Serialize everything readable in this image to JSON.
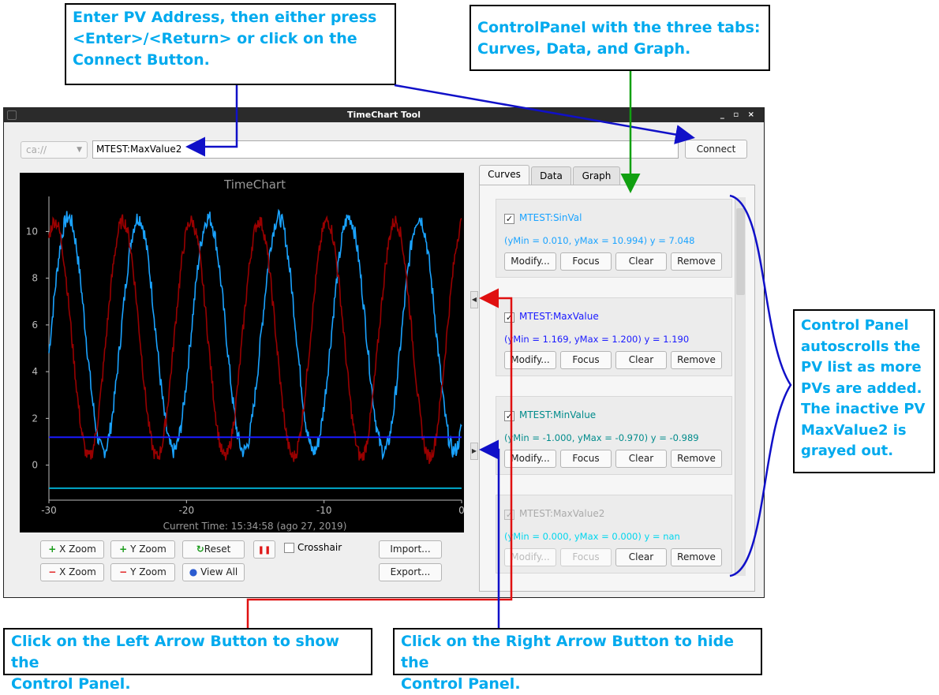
{
  "annotations": {
    "pv_address": [
      "Enter PV Address, then either press",
      "<Enter>/<Return> or click on the",
      "Connect Button."
    ],
    "control_panel_tabs": [
      "ControlPanel with the three tabs:",
      "Curves, Data, and Graph."
    ],
    "autoscroll": [
      "Control Panel",
      "autoscrolls the",
      "PV list as more",
      "PVs are added.",
      "The inactive PV",
      "MaxValue2 is",
      "grayed out."
    ],
    "left_arrow": [
      "Click on the Left Arrow Button to show the",
      "Control Panel."
    ],
    "right_arrow": [
      "Click on the Right Arrow Button to hide the",
      "Control Panel."
    ]
  },
  "window": {
    "title": "TimeChart Tool"
  },
  "toolbar": {
    "protocol": "ca://",
    "pv_value": "MTEST:MaxValue2",
    "connect_label": "Connect"
  },
  "chart_data": {
    "type": "line",
    "title": "TimeChart",
    "footer": "Current Time: 15:34:58 (ago 27, 2019)",
    "xlim": [
      -30,
      0
    ],
    "ylim": [
      -1.5,
      11.5
    ],
    "xticks": [
      -30,
      -20,
      -10,
      0
    ],
    "yticks": [
      0,
      2,
      4,
      6,
      8,
      10
    ],
    "series": [
      {
        "name": "MTEST:SinVal",
        "color": "#1aa3ff",
        "period": 5.1,
        "phase": -0.9,
        "amp": 5.0,
        "offset": 5.6,
        "noise": 0.35
      },
      {
        "name": "MTEST:MaxValue",
        "color": "#990000",
        "period": 4.95,
        "phase": 1.4,
        "amp": 5.05,
        "offset": 5.4,
        "noise": 0.3
      },
      {
        "name": "MTEST:MinValue",
        "color": "#1a1aff",
        "constant": 1.19
      },
      {
        "name": "MTEST:MaxValue2",
        "color": "#00aacc",
        "constant": -0.99
      }
    ]
  },
  "controls": {
    "x_zoom_in": "X Zoom",
    "y_zoom_in": "Y Zoom",
    "reset": "Reset",
    "crosshair": "Crosshair",
    "import": "Import...",
    "x_zoom_out": "X Zoom",
    "y_zoom_out": "Y Zoom",
    "view_all": "View All",
    "export": "Export..."
  },
  "tabs": [
    "Curves",
    "Data",
    "Graph"
  ],
  "curves": [
    {
      "name": "MTEST:SinVal",
      "stats": "(yMin = 0.010, yMax = 10.994) y = 7.048",
      "color": "#1aa3ff",
      "checked": "✓"
    },
    {
      "name": "MTEST:MaxValue",
      "stats": "(yMin = 1.169, yMax = 1.200) y = 1.190",
      "color": "#1a1aff",
      "checked": "✓"
    },
    {
      "name": "MTEST:MinValue",
      "stats": "(yMin = -1.000, yMax = -0.970) y = -0.989",
      "color": "#008b8b",
      "checked": "✓"
    },
    {
      "name": "MTEST:MaxValue2",
      "stats": "(yMin = 0.000, yMax = 0.000) y = nan",
      "color": "#00d6ee",
      "checked": "✓"
    }
  ],
  "curve_buttons": {
    "modify": "Modify...",
    "focus": "Focus",
    "clear": "Clear",
    "remove": "Remove"
  },
  "icons": {
    "plus": "+",
    "minus": "−",
    "reset_icon": "↻",
    "pause_icon": "❚❚",
    "globe_icon": "●",
    "left_arrow": "◀",
    "right_arrow": "▶",
    "check": "✓",
    "dropdown": "▼"
  }
}
